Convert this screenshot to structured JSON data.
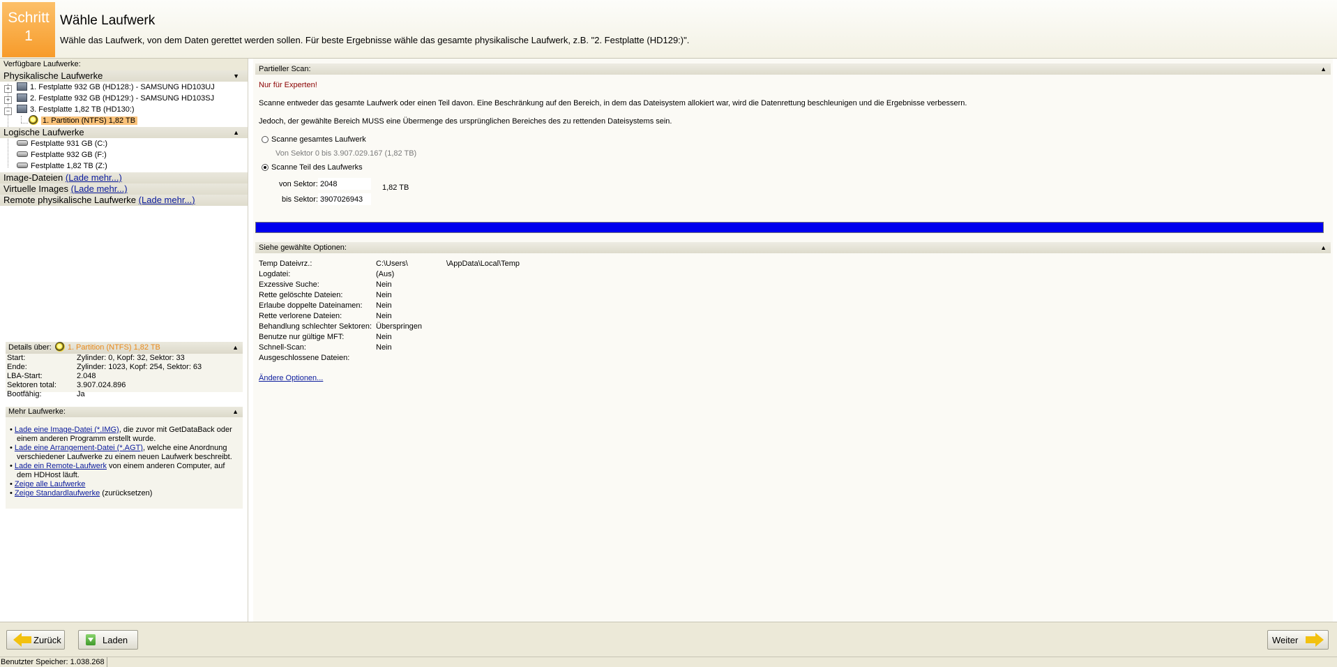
{
  "header": {
    "step_word": "Schritt",
    "step_number": "1",
    "title": "Wähle Laufwerk",
    "subtitle": "Wähle das Laufwerk, von dem Daten gerettet werden sollen. Für beste Ergebnisse wähle das gesamte physikalische Laufwerk, z.B. \"2. Festplatte (HD129:)\"."
  },
  "left": {
    "caption": "Verfügbare Laufwerke:",
    "physical_header": "Physikalische Laufwerke",
    "physical": [
      "1. Festplatte 932 GB (HD128:) - SAMSUNG HD103UJ",
      "2. Festplatte 932 GB (HD129:) - SAMSUNG HD103SJ",
      "3. Festplatte 1,82 TB (HD130:)"
    ],
    "partition": "1. Partition (NTFS) 1,82 TB",
    "logical_header": "Logische Laufwerke",
    "logical": [
      "Festplatte 931 GB (C:)",
      "Festplatte 932 GB (F:)",
      "Festplatte 1,82 TB (Z:)"
    ],
    "image_files": "Image-Dateien",
    "virtual_images": "Virtuelle Images",
    "remote_drives": "Remote physikalische Laufwerke",
    "load_more": "(Lade mehr...)"
  },
  "details": {
    "header": "Details über:",
    "selected": "1. Partition (NTFS) 1,82 TB",
    "rows": [
      {
        "k": "Start:",
        "v": "Zylinder: 0, Kopf: 32, Sektor: 33"
      },
      {
        "k": "Ende:",
        "v": "Zylinder: 1023, Kopf: 254, Sektor: 63"
      },
      {
        "k": "LBA-Start:",
        "v": "2.048"
      },
      {
        "k": "Sektoren total:",
        "v": "3.907.024.896"
      },
      {
        "k": "Bootfähig:",
        "v": "Ja"
      }
    ]
  },
  "more_drives": {
    "header": "Mehr Laufwerke:",
    "items": [
      {
        "link": "Lade eine Image-Datei (*.IMG)",
        "text": ", die zuvor mit GetDataBack oder einem anderen Programm erstellt wurde."
      },
      {
        "link": "Lade eine Arrangement-Datei (*.AGT)",
        "text": ", welche eine Anordnung verschiedener Laufwerke zu einem neuen Laufwerk beschreibt."
      },
      {
        "link": "Lade ein Remote-Laufwerk",
        "text": " von einem anderen Computer, auf dem HDHost läuft."
      },
      {
        "link": "Zeige alle Laufwerke",
        "text": ""
      },
      {
        "link": "Zeige Standardlaufwerke",
        "text": " (zurücksetzen)"
      }
    ]
  },
  "partial_scan": {
    "header": "Partieller Scan:",
    "experts": "Nur für Experten!",
    "desc1": "Scanne entweder das gesamte Laufwerk oder einen Teil davon. Eine Beschränkung auf den Bereich, in dem das Dateisystem allokiert war, wird die Datenrettung beschleunigen und die Ergebnisse verbessern.",
    "desc2": "Jedoch, der gewählte Bereich MUSS eine Übermenge des ursprünglichen Bereiches des zu rettenden Dateisystems sein.",
    "opt_full": "Scanne gesamtes Laufwerk",
    "full_range": "Von Sektor 0 bis 3.907.029.167 (1,82 TB)",
    "opt_part": "Scanne Teil des Laufwerks",
    "from_label": "von Sektor:",
    "from_value": "2048",
    "to_label": "bis Sektor:",
    "to_value": "3907026943",
    "size": "1,82 TB",
    "progress": 1.0
  },
  "options": {
    "header": "Siehe gewählte Optionen:",
    "rows": [
      {
        "k": "Temp Dateivrz.:",
        "v": "C:\\Users\\                  \\AppData\\Local\\Temp"
      },
      {
        "k": "Logdatei:",
        "v": "(Aus)"
      },
      {
        "k": "Exzessive Suche:",
        "v": "Nein"
      },
      {
        "k": "Rette gelöschte Dateien:",
        "v": "Nein"
      },
      {
        "k": "Erlaube doppelte Dateinamen:",
        "v": "Nein"
      },
      {
        "k": "Rette verlorene Dateien:",
        "v": "Nein"
      },
      {
        "k": "Behandlung schlechter Sektoren:",
        "v": "Überspringen"
      },
      {
        "k": "Benutze nur gültige MFT:",
        "v": "Nein"
      },
      {
        "k": "Schnell-Scan:",
        "v": "Nein"
      },
      {
        "k": "Ausgeschlossene Dateien:",
        "v": ""
      }
    ],
    "change_link": "Ändere Optionen..."
  },
  "buttons": {
    "back": "Zurück",
    "load": "Laden",
    "next": "Weiter"
  },
  "status": {
    "memory": "Benutzter Speicher: 1.038.268"
  },
  "icons": {
    "disk": "hard-disk-icon",
    "partition": "partition-icon",
    "logical": "logical-drive-icon"
  },
  "colors": {
    "accent_orange": "#f79b2a",
    "selection": "#f9c27a",
    "progress": "#0000ee",
    "expert_warning": "#8b0000"
  }
}
